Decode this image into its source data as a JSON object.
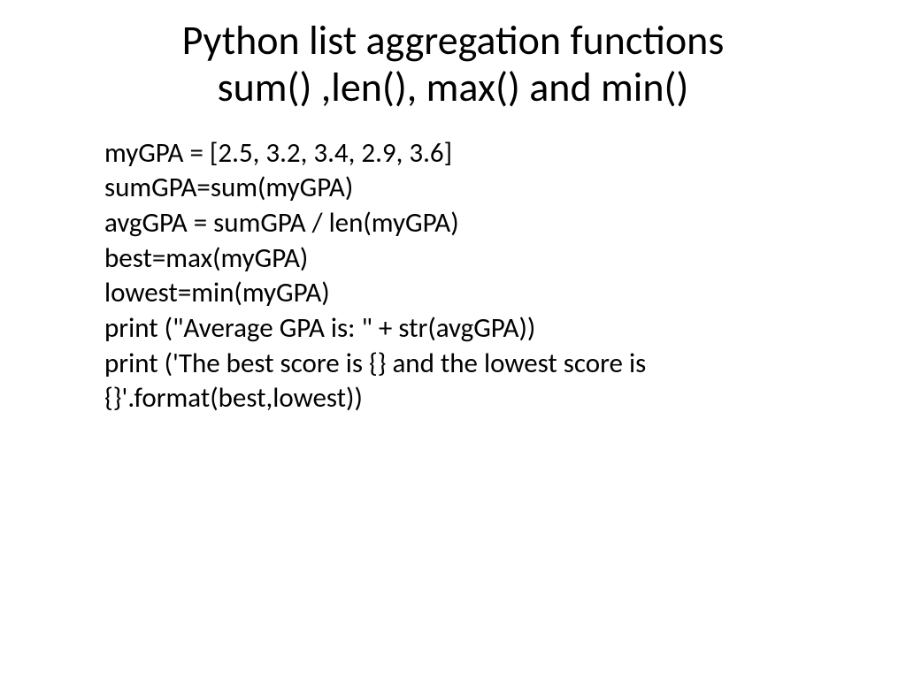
{
  "slide": {
    "title_line1": "Python list aggregation functions",
    "title_line2": "sum() ,len(), max() and min()",
    "code": {
      "line1": "myGPA = [2.5, 3.2, 3.4, 2.9, 3.6]",
      "line2": "sumGPA=sum(myGPA)",
      "line3": "avgGPA = sumGPA / len(myGPA)",
      "line4": "best=max(myGPA)",
      "line5": "lowest=min(myGPA)",
      "line6": "print (\"Average GPA is: \" + str(avgGPA))",
      "line7": "print ('The best score is {} and the lowest score is {}'.format(best,lowest))"
    }
  }
}
